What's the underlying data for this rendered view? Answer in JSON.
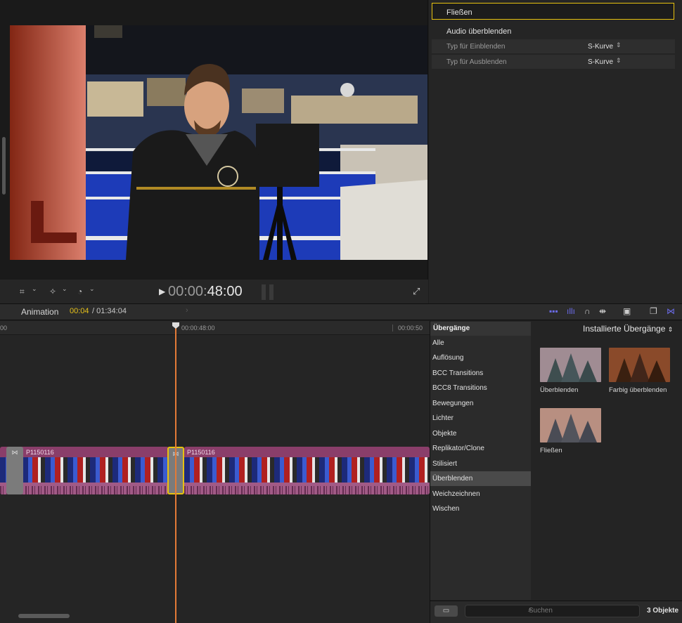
{
  "viewer": {
    "timecode_dim": "00:00:",
    "timecode_bright": "48:00",
    "tools": [
      "crop-icon",
      "chevron-down-icon",
      "magic-wand-icon",
      "chevron-down-icon",
      "speedometer-icon",
      "chevron-down-icon"
    ],
    "fullscreen_icon": "fullscreen-icon"
  },
  "inspector": {
    "transition_name": "Fließen",
    "audio_section": "Audio überblenden",
    "rows": [
      {
        "label": "Typ für Einblenden",
        "value": "S-Kurve"
      },
      {
        "label": "Typ für Ausblenden",
        "value": "S-Kurve"
      }
    ]
  },
  "timeline": {
    "project": "Animation",
    "position": "00:04",
    "duration": "/ 01:34:04",
    "ruler": [
      "00",
      "00:00:48:00",
      "00:00:50"
    ],
    "clips": [
      {
        "name": "P1150116"
      },
      {
        "name": "P1150116"
      }
    ]
  },
  "browser": {
    "header": "Übergänge",
    "dropdown": "Installierte Übergänge",
    "categories": [
      "Alle",
      "Auflösung",
      "BCC Transitions",
      "BCC8 Transitions",
      "Bewegungen",
      "Lichter",
      "Objekte",
      "Replikator/Clone",
      "Stilisiert",
      "Überblenden",
      "Weichzeichnen",
      "Wischen"
    ],
    "selected_category": "Überblenden",
    "items": [
      {
        "label": "Überblenden"
      },
      {
        "label": "Farbig überblenden"
      },
      {
        "label": "Fließen"
      }
    ],
    "search_placeholder": "Suchen",
    "count": "3 Objekte"
  },
  "colors": {
    "accent_yellow": "#e8c20f",
    "clip_pink": "#8a3e6a",
    "playhead_orange": "#e37a37",
    "header_blue": "#6b6be8"
  }
}
